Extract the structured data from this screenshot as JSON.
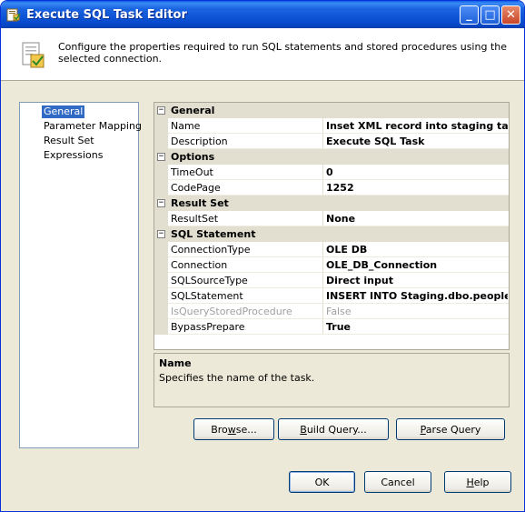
{
  "window": {
    "title": "Execute SQL Task Editor",
    "buttons": {
      "minimize": "_",
      "maximize": "□",
      "close": "✕"
    }
  },
  "header": {
    "description": "Configure the properties required to run SQL statements and stored procedures using the selected connection."
  },
  "nav": {
    "items": [
      {
        "label": "General",
        "selected": true
      },
      {
        "label": "Parameter Mapping",
        "selected": false
      },
      {
        "label": "Result Set",
        "selected": false
      },
      {
        "label": "Expressions",
        "selected": false
      }
    ]
  },
  "properties": {
    "expander_symbol": "−",
    "categories": [
      {
        "label": "General",
        "rows": [
          {
            "name": "Name",
            "value": "Inset XML record into staging table"
          },
          {
            "name": "Description",
            "value": "Execute SQL Task"
          }
        ]
      },
      {
        "label": "Options",
        "rows": [
          {
            "name": "TimeOut",
            "value": "0"
          },
          {
            "name": "CodePage",
            "value": "1252"
          }
        ]
      },
      {
        "label": "Result Set",
        "rows": [
          {
            "name": "ResultSet",
            "value": "None"
          }
        ]
      },
      {
        "label": "SQL Statement",
        "rows": [
          {
            "name": "ConnectionType",
            "value": "OLE DB"
          },
          {
            "name": "Connection",
            "value": "OLE_DB_Connection"
          },
          {
            "name": "SQLSourceType",
            "value": "Direct input"
          },
          {
            "name": "SQLStatement",
            "value": "INSERT INTO Staging.dbo.people_xml"
          },
          {
            "name": "IsQueryStoredProcedure",
            "value": "False",
            "disabled": true
          },
          {
            "name": "BypassPrepare",
            "value": "True"
          }
        ]
      }
    ]
  },
  "description_pane": {
    "title": "Name",
    "text": "Specifies the name of the task."
  },
  "action_buttons": {
    "browse": {
      "pre": "Bro",
      "mnemonic": "w",
      "post": "se..."
    },
    "build_query": {
      "pre": "",
      "mnemonic": "B",
      "post": "uild Query..."
    },
    "parse_query": {
      "pre": "",
      "mnemonic": "P",
      "post": "arse Query"
    }
  },
  "footer_buttons": {
    "ok": "OK",
    "cancel": "Cancel",
    "help": {
      "pre": "",
      "mnemonic": "H",
      "post": "elp"
    }
  },
  "colors": {
    "selection": "#316AC5",
    "dialog_bg": "#ECE9D8",
    "titlebar": "#0A4FD2"
  }
}
